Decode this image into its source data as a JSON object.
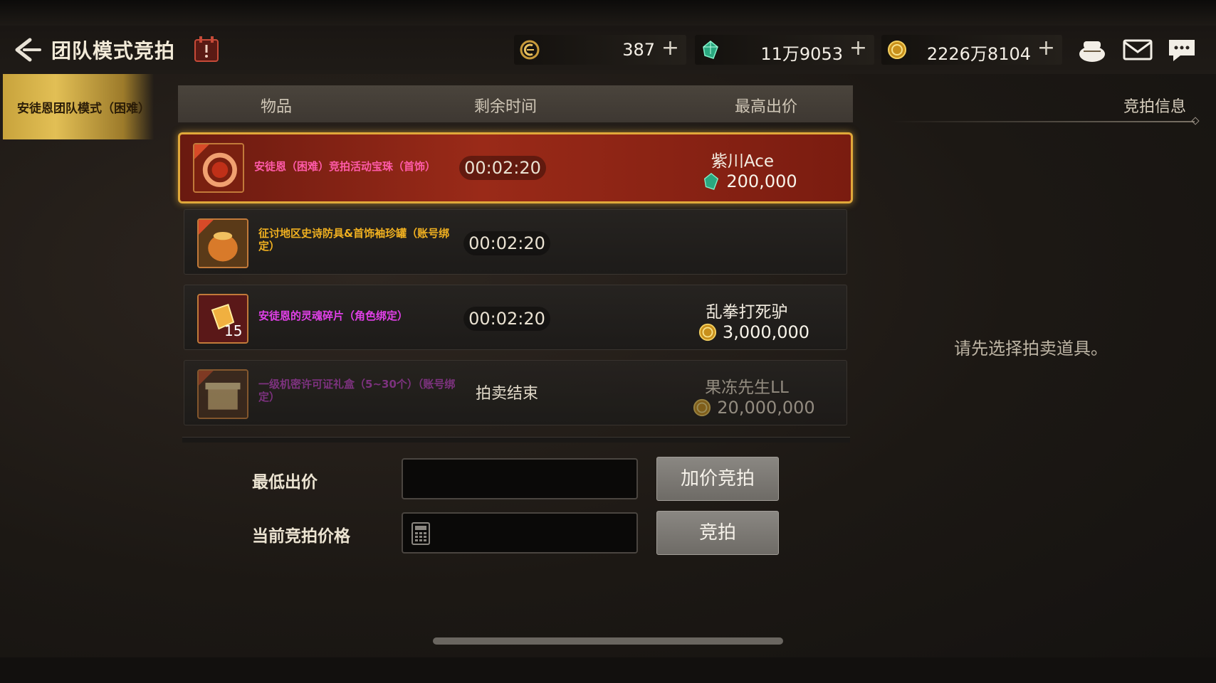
{
  "header": {
    "title": "团队模式竞拍",
    "currencies": [
      {
        "icon": "crescent-token-icon",
        "value": "387"
      },
      {
        "icon": "green-crystal-icon",
        "value": "11万9053"
      },
      {
        "icon": "gold-coin-icon",
        "value": "2226万8104"
      }
    ],
    "plus_label": "+"
  },
  "sidebar": {
    "items": [
      {
        "label": "安徒恩团队模式（困难）",
        "active": true
      }
    ]
  },
  "table": {
    "columns": [
      "物品",
      "剩余时间",
      "最高出价"
    ],
    "rows": [
      {
        "name": "安徒恩（困难）竞拍活动宝珠（首饰）",
        "name_color": "#ff5aa8",
        "time": "00:02:20",
        "bidder": "紫川Ace",
        "bid": "200,000",
        "bid_icon": "green-crystal-icon",
        "selected": true
      },
      {
        "name": "征讨地区史诗防具&首饰袖珍罐（账号绑定）",
        "name_color": "#f0b020",
        "time": "00:02:20",
        "bidder": "",
        "bid": "",
        "bid_icon": ""
      },
      {
        "name": "安徒恩的灵魂碎片（角色绑定）",
        "name_color": "#e040e8",
        "time": "00:02:20",
        "bidder": "乱拳打死驴",
        "bid": "3,000,000",
        "bid_icon": "gold-coin-icon",
        "quantity": "15"
      },
      {
        "name": "一级机密许可证礼盒（5~30个）（账号绑定）",
        "name_color": "#c040c8",
        "status": "拍卖结束",
        "bidder": "果冻先生LL",
        "bid": "20,000,000",
        "bid_icon": "gold-coin-icon",
        "ended": true
      }
    ]
  },
  "form": {
    "min_bid_label": "最低出价",
    "current_price_label": "当前竞拍价格",
    "raise_button": "加价竞拍",
    "bid_button": "竞拍"
  },
  "info_panel": {
    "tab": "竞拍信息",
    "hint": "请先选择拍卖道具。"
  }
}
